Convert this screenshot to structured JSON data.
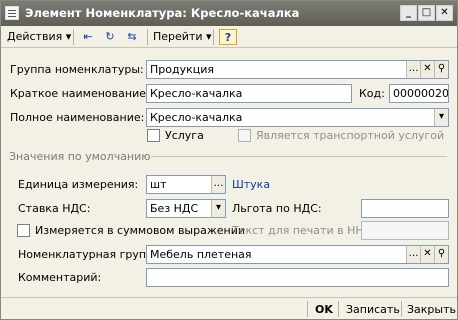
{
  "window": {
    "title": "Элемент Номенклатура: Кресло-качалка",
    "controls": {
      "minimize": "_",
      "maximize": "□",
      "close": "✕"
    }
  },
  "toolbar": {
    "actions_label": "Действия ▾",
    "goto_label": "Перейти ▾",
    "help_label": "?"
  },
  "form": {
    "group_label": "Группа номенклатуры:",
    "group_value": "Продукция",
    "short_name_label": "Краткое наименование:",
    "short_name_value": "Кресло-качалка",
    "code_label": "Код:",
    "code_value": "00000020",
    "full_name_label": "Полное наименование:",
    "full_name_value": "Кресло-качалка",
    "service_label": "Услуга",
    "transport_label": "Является транспортной услугой"
  },
  "defaults": {
    "section_title": "Значения по умолчанию",
    "unit_label": "Единица измерения:",
    "unit_value": "шт",
    "unit_link": "Штука",
    "vat_label": "Ставка НДС:",
    "vat_value": "Без НДС",
    "vat_benefit_label": "Льгота по НДС:",
    "vat_benefit_value": "",
    "sum_measure_label": "Измеряется в суммовом выражении",
    "print_text_label": "Текст для печати в НН:",
    "print_text_value": "",
    "nom_group_label": "Номенклатурная группа:",
    "nom_group_value": "Мебель плетеная",
    "comment_label": "Комментарий:",
    "comment_value": ""
  },
  "footer": {
    "ok": "OK",
    "save": "Записать",
    "close": "Закрыть"
  },
  "colors": {
    "title_bar": "#6e6d66",
    "form_bg": "#f3f1e6",
    "link": "#0c3899"
  }
}
